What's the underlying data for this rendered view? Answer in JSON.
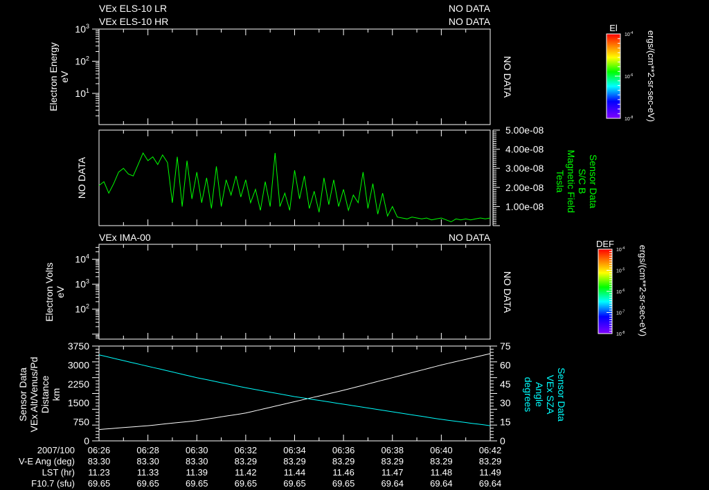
{
  "panel1": {
    "title_lr": "VEx ELS-10 LR",
    "title_hr": "VEx ELS-10 HR",
    "nodata_lr": "NO DATA",
    "nodata_hr": "NO DATA",
    "nodata_side": "NO DATA",
    "ylabel": "Electron Energy",
    "yunit": "eV",
    "yticks": [
      {
        "base": "10",
        "exp": "3",
        "log": 3
      },
      {
        "base": "10",
        "exp": "2",
        "log": 2
      },
      {
        "base": "10",
        "exp": "1",
        "log": 1
      }
    ],
    "ylog_range": [
      0.03,
      3
    ]
  },
  "colorbar1": {
    "title": "El",
    "unit": "ergs/(cm**2-sr-sec-eV)",
    "ticks": [
      {
        "base": "10",
        "exp": "-4"
      },
      {
        "base": "10",
        "exp": "-6"
      },
      {
        "base": "10",
        "exp": "-8"
      }
    ]
  },
  "panel2": {
    "nodata_side": "NO DATA",
    "label_lines": [
      "Sensor Data",
      "S/C B",
      "Magnetic Field",
      "Tesla"
    ],
    "yticks": [
      "5.00e-08",
      "4.00e-08",
      "3.00e-08",
      "2.00e-08",
      "1.00e-08"
    ],
    "color": "#00ff00"
  },
  "panel3": {
    "title": "VEx IMA-00",
    "nodata_top": "NO DATA",
    "nodata_side": "NO DATA",
    "ylabel": "Electron Volts",
    "yunit": "eV",
    "yticks": [
      {
        "base": "10",
        "exp": "4",
        "log": 4
      },
      {
        "base": "10",
        "exp": "3",
        "log": 3
      },
      {
        "base": "10",
        "exp": "2",
        "log": 2
      }
    ],
    "ylog_range": [
      0.8,
      4.6
    ]
  },
  "colorbar2": {
    "title": "DEF",
    "unit": "ergs/(cm**2-sr-sec-eV)",
    "ticks": [
      {
        "base": "10",
        "exp": "-4"
      },
      {
        "base": "10",
        "exp": "-5"
      },
      {
        "base": "10",
        "exp": "-6"
      },
      {
        "base": "10",
        "exp": "-7"
      },
      {
        "base": "10",
        "exp": "-8"
      }
    ]
  },
  "panel4": {
    "left_label_lines": [
      "Sensor Data",
      "VEx Alt/Venus/Pd",
      "Distance",
      "km"
    ],
    "right_label_lines": [
      "Sensor Data",
      "VEx SZA",
      "Angle",
      "degrees"
    ],
    "left_ticks": [
      "3750",
      "3000",
      "2250",
      "1500",
      "750",
      "0"
    ],
    "right_ticks": [
      "75",
      "60",
      "45",
      "30",
      "15",
      "0"
    ]
  },
  "footer": {
    "row_labels": [
      "2007/100",
      "V-E Ang (deg)",
      "LST (hr)",
      "F10.7 (sfu)"
    ],
    "columns": [
      [
        "06:26",
        "83.30",
        "11.23",
        "69.65"
      ],
      [
        "06:28",
        "83.30",
        "11.33",
        "69.65"
      ],
      [
        "06:30",
        "83.30",
        "11.39",
        "69.65"
      ],
      [
        "06:32",
        "83.29",
        "11.42",
        "69.65"
      ],
      [
        "06:34",
        "83.29",
        "11.44",
        "69.65"
      ],
      [
        "06:36",
        "83.29",
        "11.46",
        "69.65"
      ],
      [
        "06:38",
        "83.29",
        "11.47",
        "69.64"
      ],
      [
        "06:40",
        "83.29",
        "11.48",
        "69.64"
      ],
      [
        "06:42",
        "83.29",
        "11.49",
        "69.64"
      ]
    ]
  },
  "chart_data": [
    {
      "type": "heatmap",
      "title": "VEx ELS-10 LR / HR",
      "ylabel": "Electron Energy (eV)",
      "status": "NO DATA"
    },
    {
      "type": "line",
      "title": "S/C B Magnetic Field",
      "ylabel": "Tesla",
      "ylim": [
        0,
        5e-08
      ],
      "x_unit": "minutes after 06:26",
      "x_step": 0.2,
      "y_scale": 1e-08,
      "values": [
        2.1,
        2.3,
        1.7,
        2.2,
        2.8,
        3.0,
        2.7,
        2.6,
        3.2,
        3.8,
        3.4,
        3.6,
        3.2,
        3.7,
        3.3,
        1.2,
        3.6,
        1.0,
        3.4,
        1.4,
        2.8,
        1.2,
        2.5,
        0.9,
        3.1,
        1.0,
        2.4,
        1.6,
        2.6,
        1.5,
        2.4,
        1.2,
        1.9,
        0.8,
        2.3,
        1.0,
        3.8,
        1.0,
        1.7,
        0.8,
        2.9,
        1.4,
        2.6,
        0.9,
        1.8,
        0.7,
        2.5,
        1.1,
        2.4,
        1.0,
        1.9,
        0.8,
        1.6,
        1.2,
        2.8,
        0.9,
        2.2,
        0.6,
        1.7,
        0.5,
        1.0,
        0.45,
        0.4,
        0.35,
        0.45,
        0.4,
        0.35,
        0.4,
        0.3,
        0.35,
        0.4,
        0.3,
        0.2,
        0.35,
        0.3,
        0.35,
        0.3,
        0.35,
        0.4,
        0.35,
        0.4
      ]
    },
    {
      "type": "heatmap",
      "title": "VEx IMA-00",
      "ylabel": "Electron Volts (eV)",
      "status": "NO DATA"
    },
    {
      "type": "line",
      "x_unit": "minutes after 06:26",
      "x": [
        0,
        2,
        4,
        6,
        8,
        10,
        12,
        14,
        16
      ],
      "series": [
        {
          "name": "VEx Alt/Venus/Pd Distance (km)",
          "axis": "left",
          "ylim": [
            0,
            3750
          ],
          "color": "#ffffff",
          "values": [
            450,
            600,
            800,
            1100,
            1550,
            2000,
            2500,
            3000,
            3450
          ]
        },
        {
          "name": "VEx SZA Angle (degrees)",
          "axis": "right",
          "ylim": [
            0,
            75
          ],
          "color": "#00ffff",
          "values": [
            68,
            59,
            50,
            42,
            35,
            29,
            23,
            17,
            12
          ]
        }
      ]
    }
  ]
}
